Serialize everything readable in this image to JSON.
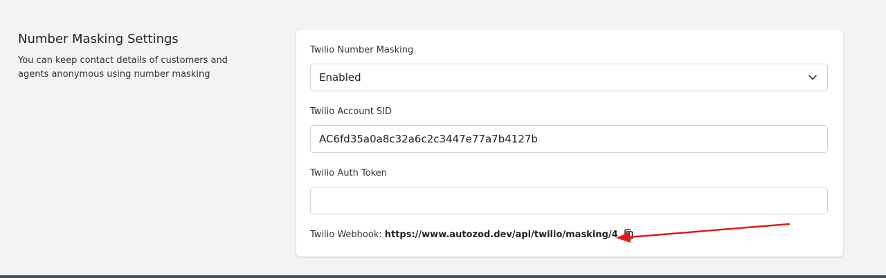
{
  "section": {
    "title": "Number Masking Settings",
    "description": "You can keep contact details of customers and agents anonymous using number masking"
  },
  "form": {
    "masking": {
      "label": "Twilio Number Masking",
      "value": "Enabled",
      "icon": "chevron-down-icon"
    },
    "account_sid": {
      "label": "Twilio Account SID",
      "value": "AC6fd35a0a8c32a6c2c3447e77a7b4127b"
    },
    "auth_token": {
      "label": "Twilio Auth Token",
      "value": ""
    },
    "webhook": {
      "label": "Twilio Webhook:",
      "url": "https://www.autozod.dev/api/twilio/masking/4",
      "icon": "copy-icon"
    }
  },
  "annotation": {
    "arrow_color": "#e01b1b"
  }
}
